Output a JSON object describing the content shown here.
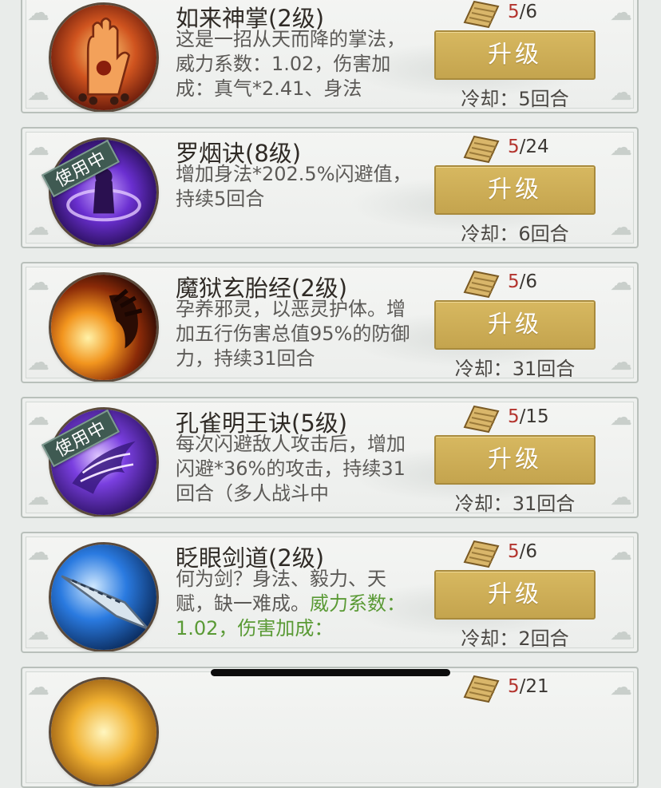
{
  "colors": {
    "accent_gold": "#cdb055",
    "count_red": "#b3342e",
    "highlight_green": "#5a9a35",
    "tag_green": "#3f5a52"
  },
  "skills": [
    {
      "name": "如来神掌(2级)",
      "desc": "这是一招从天而降的掌法，威力系数：1.02，伤害加成：真气*2.41、身法",
      "desc_highlight": "",
      "have": "5",
      "need": "/6",
      "upgrade": "升级",
      "cooldown": "冷却：5回合",
      "tag": "",
      "icon": "palm-icon"
    },
    {
      "name": "罗烟诀(8级)",
      "desc": "增加身法*202.5%闪避值，持续5回合",
      "desc_highlight": "",
      "have": "5",
      "need": "/24",
      "upgrade": "升级",
      "cooldown": "冷却：6回合",
      "tag": "使用中",
      "icon": "shadow-vortex-icon"
    },
    {
      "name": "魔狱玄胎经(2级)",
      "desc": "孕养邪灵，以恶灵护体。增加五行伤害总值95%的防御力，持续31回合",
      "desc_highlight": "",
      "have": "5",
      "need": "/6",
      "upgrade": "升级",
      "cooldown": "冷却：31回合",
      "tag": "",
      "icon": "demon-claw-icon"
    },
    {
      "name": "孔雀明王诀(5级)",
      "desc": "每次闪避敌人攻击后，增加闪避*36%的攻击，持续31回合（多人战斗中",
      "desc_highlight": "",
      "have": "5",
      "need": "/15",
      "upgrade": "升级",
      "cooldown": "冷却：31回合",
      "tag": "使用中",
      "icon": "peacock-icon"
    },
    {
      "name": "眨眼剑道(2级)",
      "desc": "何为剑？身法、毅力、天赋，缺一难成。",
      "desc_highlight": "威力系数：1.02，伤害加成：",
      "have": "5",
      "need": "/6",
      "upgrade": "升级",
      "cooldown": "冷却：2回合",
      "tag": "",
      "icon": "sword-icon"
    },
    {
      "name": "",
      "desc": "",
      "desc_highlight": "",
      "have": "5",
      "need": "/21",
      "upgrade": "",
      "cooldown": "",
      "tag": "",
      "icon": "sun-icon"
    }
  ]
}
